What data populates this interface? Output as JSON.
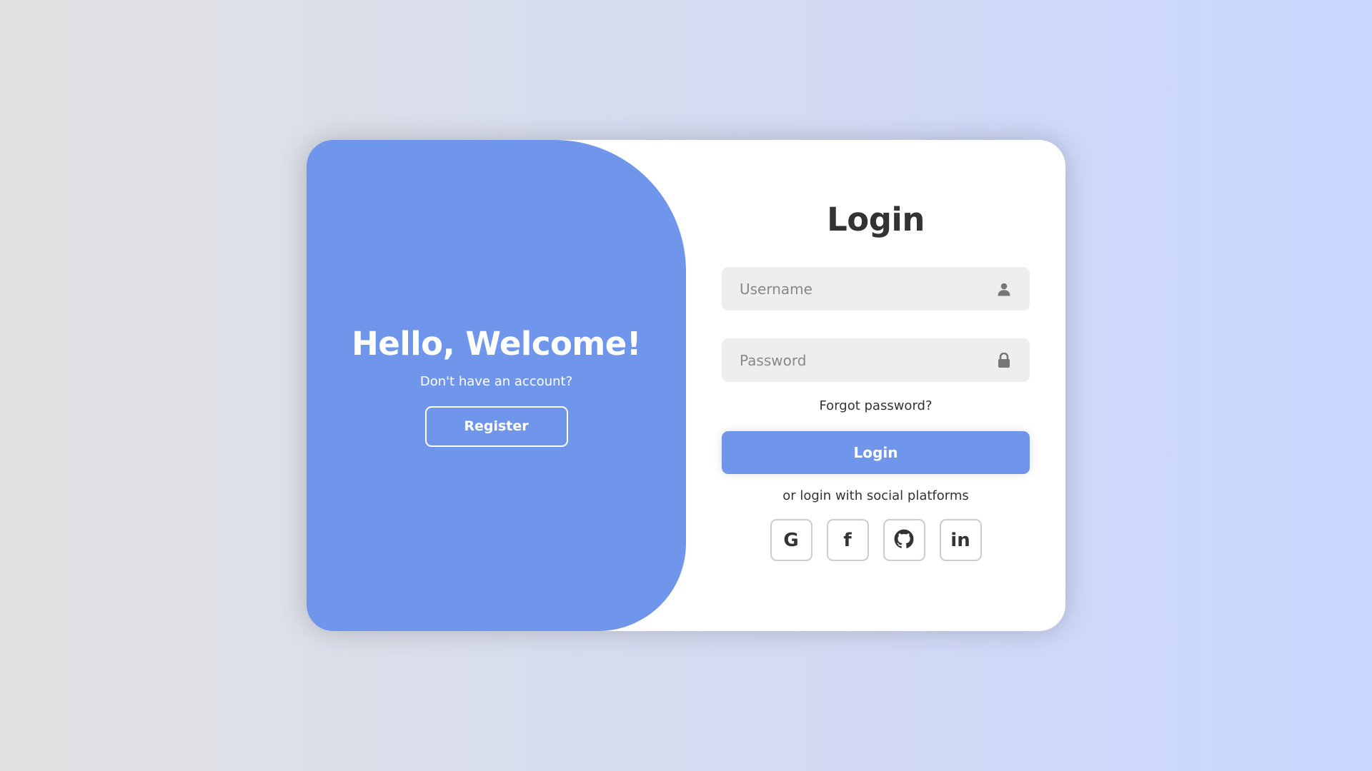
{
  "colors": {
    "accent": "#7096eb",
    "text": "#333333",
    "input_bg": "#eeeeee",
    "placeholder": "#888888"
  },
  "welcome_panel": {
    "title": "Hello, Welcome!",
    "subtitle": "Don't have an account?",
    "register_label": "Register"
  },
  "login_form": {
    "title": "Login",
    "username": {
      "placeholder": "Username",
      "value": "",
      "icon": "user-icon"
    },
    "password": {
      "placeholder": "Password",
      "value": "",
      "icon": "lock-icon"
    },
    "forgot_label": "Forgot password?",
    "submit_label": "Login",
    "social_text": "or login with social platforms",
    "social": [
      {
        "icon": "google-icon",
        "glyph": "G"
      },
      {
        "icon": "facebook-icon",
        "glyph": "f"
      },
      {
        "icon": "github-icon",
        "glyph": ""
      },
      {
        "icon": "linkedin-icon",
        "glyph": "in"
      }
    ]
  }
}
